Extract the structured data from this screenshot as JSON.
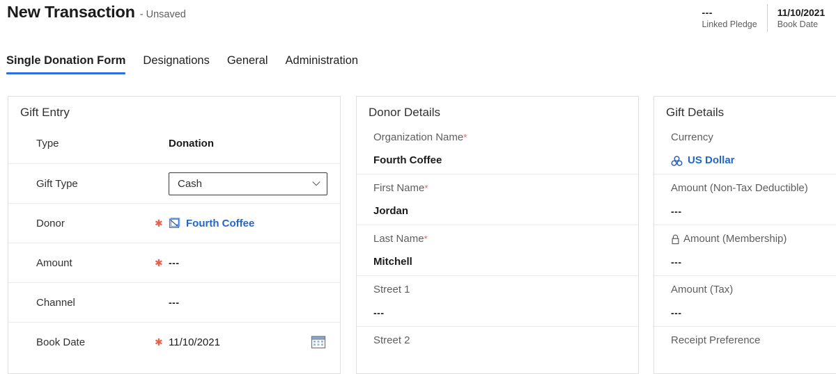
{
  "header": {
    "title": "New Transaction",
    "subtitle": "- Unsaved",
    "facts": [
      {
        "value": "---",
        "label": "Linked Pledge"
      },
      {
        "value": "11/10/2021",
        "label": "Book Date"
      }
    ]
  },
  "tabs": [
    {
      "label": "Single Donation Form",
      "active": true
    },
    {
      "label": "Designations",
      "active": false
    },
    {
      "label": "General",
      "active": false
    },
    {
      "label": "Administration",
      "active": false
    }
  ],
  "gift_entry": {
    "title": "Gift Entry",
    "rows": [
      {
        "label": "Type",
        "required": false,
        "value": "Donation"
      },
      {
        "label": "Gift Type",
        "required": false,
        "value": "Cash"
      },
      {
        "label": "Donor",
        "required": true,
        "value": "Fourth Coffee"
      },
      {
        "label": "Amount",
        "required": true,
        "value": "---"
      },
      {
        "label": "Channel",
        "required": false,
        "value": "---"
      },
      {
        "label": "Book Date",
        "required": true,
        "value": "11/10/2021"
      }
    ]
  },
  "donor_details": {
    "title": "Donor Details",
    "rows": [
      {
        "label": "Organization Name",
        "required": true,
        "value": "Fourth Coffee"
      },
      {
        "label": "First Name",
        "required": true,
        "value": "Jordan"
      },
      {
        "label": "Last Name",
        "required": true,
        "value": "Mitchell"
      },
      {
        "label": "Street 1",
        "required": false,
        "value": "---"
      },
      {
        "label": "Street 2",
        "required": false,
        "value": ""
      }
    ]
  },
  "gift_details": {
    "title": "Gift Details",
    "rows": [
      {
        "label": "Currency",
        "locked": false,
        "value": "US Dollar"
      },
      {
        "label": "Amount (Non-Tax Deductible)",
        "locked": false,
        "value": "---"
      },
      {
        "label": "Amount (Membership)",
        "locked": true,
        "value": "---"
      },
      {
        "label": "Amount (Tax)",
        "locked": false,
        "value": "---"
      },
      {
        "label": "Receipt Preference",
        "locked": false,
        "value": ""
      }
    ]
  },
  "colors": {
    "accent": "#2b6fe0",
    "link": "#2266cc",
    "required": "#e8604b"
  }
}
